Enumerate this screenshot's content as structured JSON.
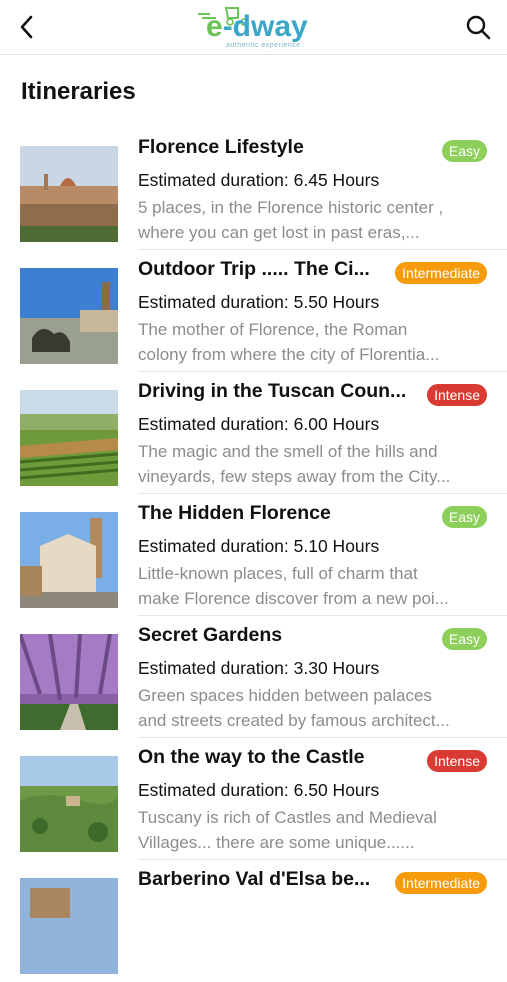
{
  "app": {
    "logo_text_e": "e",
    "logo_text_rest": "-dway",
    "logo_tagline": "authentic experience",
    "back_icon": "chevron-left-icon",
    "search_icon": "search-icon",
    "colors": {
      "brand_blue": "#3aa6c9",
      "brand_green": "#6ac259",
      "badge_easy": "#8ccf5a",
      "badge_intermediate": "#f59b0c",
      "badge_intense": "#d93a32"
    }
  },
  "page": {
    "title": "Itineraries"
  },
  "itineraries": [
    {
      "title": "Florence Lifestyle",
      "level": "Easy",
      "duration": "Estimated duration: 6.45 Hours",
      "desc_line1": "5 places, in the Florence historic center ,",
      "desc_line2": "where you can get lost in past eras,..."
    },
    {
      "title": "Outdoor Trip ..... The Ci...",
      "level": "Intermediate",
      "duration": "Estimated duration: 5.50 Hours",
      "desc_line1": "The mother of Florence, the Roman",
      "desc_line2": "colony from where the city of Florentia..."
    },
    {
      "title": "Driving in the Tuscan Coun...",
      "level": "Intense",
      "duration": "Estimated duration: 6.00 Hours",
      "desc_line1": "The magic and the smell of the hills and",
      "desc_line2": "vineyards, few steps away from the City..."
    },
    {
      "title": "The Hidden Florence",
      "level": "Easy",
      "duration": "Estimated duration: 5.10 Hours",
      "desc_line1": "Little-known places, full of charm that",
      "desc_line2": "make Florence discover from a new poi..."
    },
    {
      "title": "Secret Gardens",
      "level": "Easy",
      "duration": "Estimated duration: 3.30 Hours",
      "desc_line1": "Green spaces hidden between palaces",
      "desc_line2": "and streets created by famous architect..."
    },
    {
      "title": "On the way to the Castle",
      "level": "Intense",
      "duration": "Estimated duration: 6.50 Hours",
      "desc_line1": "Tuscany is rich of Castles and Medieval",
      "desc_line2": "Villages... there are some unique......"
    },
    {
      "title": "Barberino Val d'Elsa be...",
      "level": "Intermediate",
      "duration": "",
      "desc_line1": "",
      "desc_line2": ""
    }
  ]
}
